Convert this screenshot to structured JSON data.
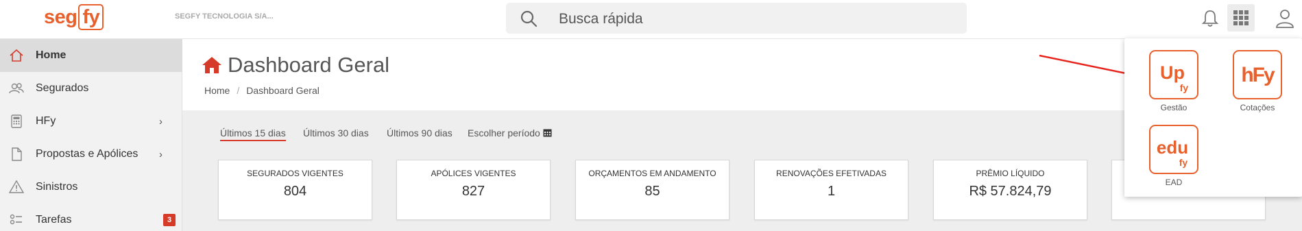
{
  "topbar": {
    "logo_left": "seg",
    "logo_box": "fy",
    "company": "SEGFY TECNOLOGIA S/A...",
    "search_placeholder": "Busca rápida",
    "icons": [
      "search-icon",
      "bell-icon",
      "apps-grid-icon",
      "user-icon"
    ]
  },
  "sidebar": {
    "items": [
      {
        "label": "Home",
        "icon": "home-icon",
        "active": true
      },
      {
        "label": "Segurados",
        "icon": "users-icon"
      },
      {
        "label": "HFy",
        "icon": "calculator-icon",
        "chevron": "›"
      },
      {
        "label": "Propostas e Apólices",
        "icon": "document-icon",
        "chevron": "›"
      },
      {
        "label": "Sinistros",
        "icon": "warning-icon"
      },
      {
        "label": "Tarefas",
        "icon": "tasks-icon",
        "badge": "3"
      }
    ]
  },
  "page": {
    "title": "Dashboard Geral",
    "breadcrumb": [
      "Home",
      "Dashboard Geral"
    ]
  },
  "periods": [
    "Últimos 15 dias",
    "Últimos 30 dias",
    "Últimos 90 dias",
    "Escolher período"
  ],
  "cards": [
    {
      "label": "SEGURADOS VIGENTES",
      "value": "804"
    },
    {
      "label": "APÓLICES VIGENTES",
      "value": "827"
    },
    {
      "label": "ORÇAMENTOS EM ANDAMENTO",
      "value": "85"
    },
    {
      "label": "RENOVAÇÕES EFETIVADAS",
      "value": "1"
    },
    {
      "label": "PRÊMIO LÍQUIDO",
      "value": "R$ 57.824,79"
    }
  ],
  "apps_menu": {
    "apps": [
      {
        "name": "Gestão",
        "logo_main": "Up",
        "logo_sub": "fy"
      },
      {
        "name": "Cotações",
        "logo_main": "hFy"
      },
      {
        "name": "EAD",
        "logo_main": "edu",
        "logo_sub": "fy"
      }
    ]
  },
  "colors": {
    "brand": "#e8602c",
    "accent_red": "#d63b2a",
    "arrow": "#e8231c"
  }
}
